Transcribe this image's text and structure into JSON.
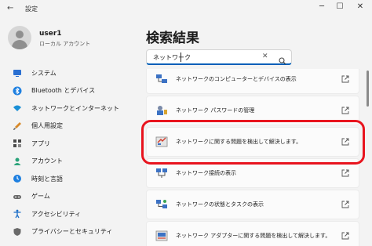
{
  "window": {
    "title": "設定",
    "back_glyph": "←",
    "controls": {
      "minimize": "─",
      "maximize": "☐",
      "close": "✕"
    }
  },
  "profile": {
    "name": "user1",
    "account": "ローカル アカウント"
  },
  "sidebar": {
    "items": [
      {
        "label": "システム",
        "icon": "system-icon"
      },
      {
        "label": "Bluetooth とデバイス",
        "icon": "bluetooth-icon"
      },
      {
        "label": "ネットワークとインターネット",
        "icon": "network-icon"
      },
      {
        "label": "個人用設定",
        "icon": "brush-icon"
      },
      {
        "label": "アプリ",
        "icon": "apps-icon"
      },
      {
        "label": "アカウント",
        "icon": "account-icon"
      },
      {
        "label": "時刻と言語",
        "icon": "time-language-icon"
      },
      {
        "label": "ゲーム",
        "icon": "game-icon"
      },
      {
        "label": "アクセシビリティ",
        "icon": "accessibility-icon"
      },
      {
        "label": "プライバシーとセキュリティ",
        "icon": "shield-icon"
      }
    ]
  },
  "main": {
    "heading": "検索結果",
    "search": {
      "value": "ネットワーク",
      "clear_glyph": "✕"
    },
    "results": [
      {
        "label": "ネットワークのコンピューターとデバイスの表示",
        "icon": "network-computers-icon"
      },
      {
        "label": "ネットワーク パスワードの管理",
        "icon": "network-password-icon"
      },
      {
        "label": "ネットワークに関する問題を検出して解決します。",
        "icon": "troubleshoot-icon",
        "highlighted": true
      },
      {
        "label": "ネットワーク接続の表示",
        "icon": "network-connections-icon"
      },
      {
        "label": "ネットワークの状態とタスクの表示",
        "icon": "network-status-icon"
      },
      {
        "label": "ネットワーク アダプターに関する問題を検出して解決します。",
        "icon": "adapter-troubleshoot-icon"
      }
    ]
  },
  "colors": {
    "accent": "#005fb8",
    "highlight": "#e8141e",
    "background": "#f3f3f3"
  }
}
